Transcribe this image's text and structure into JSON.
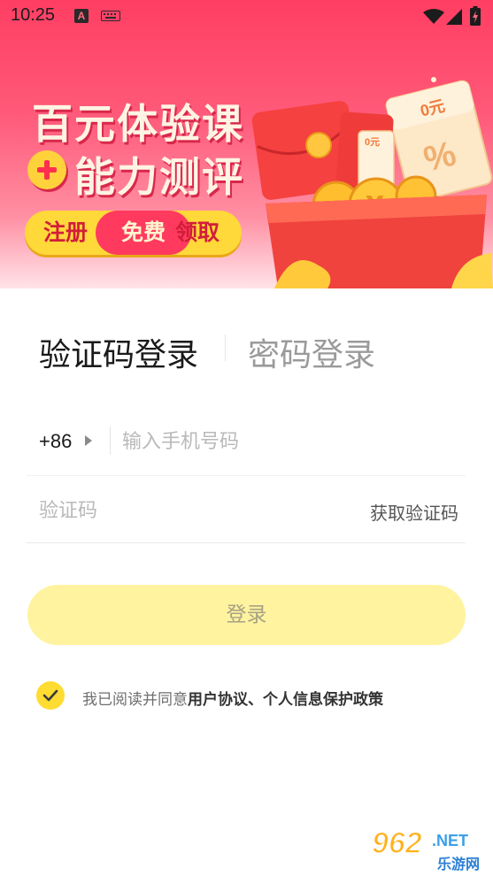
{
  "status_bar": {
    "time": "10:25",
    "notif_letter": "A",
    "icons": [
      "a-notification-icon",
      "keyboard-icon",
      "wifi-icon",
      "signal-icon",
      "battery-charging-icon"
    ]
  },
  "banner": {
    "title": "百元体验课",
    "subtitle": "能力测评",
    "pill_left": "注册",
    "pill_mid": "免费",
    "pill_right": "领取",
    "ticket_text": "0元",
    "small_ticket_text": "0元",
    "colors": {
      "top": "#ff3e63",
      "bottom": "#ffe3e8",
      "title_text": "#fff4e4",
      "pill": "#ffd83a",
      "pill_mid": "#ff3a5e"
    }
  },
  "tabs": {
    "sms_login": "验证码登录",
    "password_login": "密码登录",
    "active": "sms_login"
  },
  "form": {
    "country_code": "+86",
    "phone_placeholder": "输入手机号码",
    "phone_value": "",
    "code_placeholder": "验证码",
    "code_value": "",
    "get_code_label": "获取验证码"
  },
  "login_button": {
    "label": "登录",
    "color": "#fff3a0"
  },
  "agreement": {
    "checked": true,
    "prefix": "我已阅读并同意",
    "links": "用户协议、个人信息保护政策",
    "check_color": "#ffdc32"
  },
  "watermark": {
    "number": "962",
    "suffix": ".NET",
    "site": "乐游网"
  }
}
